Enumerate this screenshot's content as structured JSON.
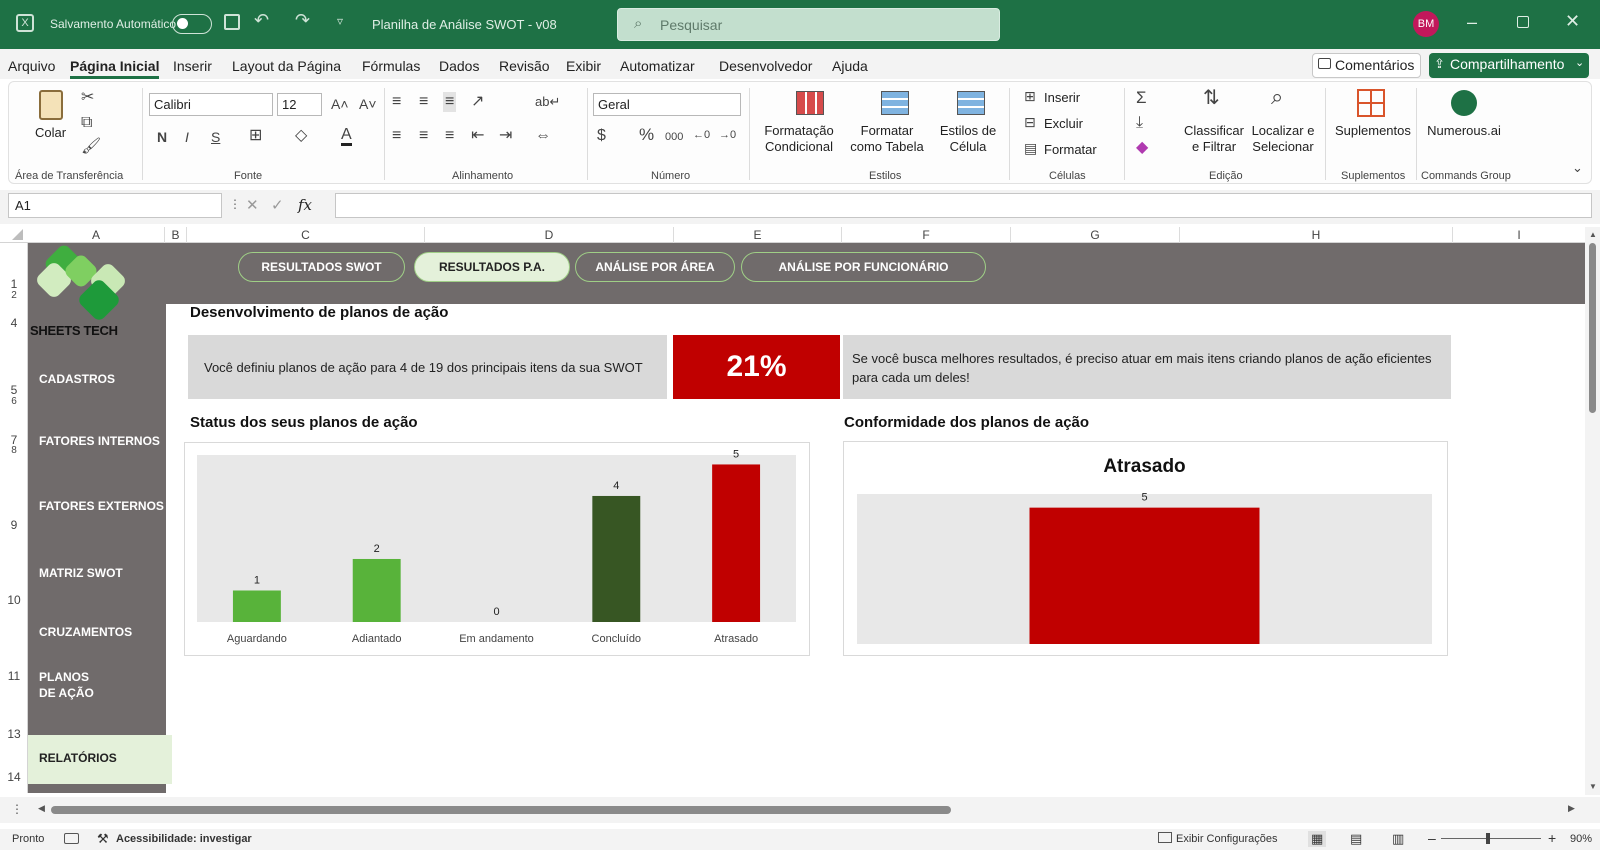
{
  "titlebar": {
    "autosave_label": "Salvamento Automático",
    "doc_title": "Planilha de Análise SWOT - v08",
    "search_placeholder": "Pesquisar",
    "user_initials": "BM",
    "accent": "#1e7145"
  },
  "menu": {
    "items": [
      "Arquivo",
      "Página Inicial",
      "Inserir",
      "Layout da Página",
      "Fórmulas",
      "Dados",
      "Revisão",
      "Exibir",
      "Automatizar",
      "Desenvolvedor",
      "Ajuda"
    ],
    "active": "Página Inicial",
    "comments": "Comentários",
    "share": "Compartilhamento"
  },
  "ribbon": {
    "paste": "Colar",
    "clipboard_group": "Área de Transferência",
    "font_name": "Calibri",
    "font_size": "12",
    "font_group": "Fonte",
    "align_group": "Alinhamento",
    "number_format": "Geral",
    "number_group": "Número",
    "cond_format": "Formatação Condicional",
    "format_table": "Formatar como Tabela",
    "cell_styles": "Estilos de Célula",
    "styles_group": "Estilos",
    "insert": "Inserir",
    "delete": "Excluir",
    "format": "Formatar",
    "cells_group": "Células",
    "sort_filter": "Classificar e Filtrar",
    "find_select": "Localizar e Selecionar",
    "editing_group": "Edição",
    "addins": "Suplementos",
    "addins_group": "Suplementos",
    "numerous": "Numerous.ai",
    "commands_group": "Commands Group"
  },
  "formula_bar": {
    "name_box": "A1",
    "fx": "fx"
  },
  "columns": [
    "A",
    "B",
    "C",
    "D",
    "E",
    "F",
    "G",
    "H",
    "I"
  ],
  "rows": [
    "1",
    "2",
    "4",
    "5",
    "6",
    "7",
    "8",
    "9",
    "10",
    "11",
    "13",
    "14"
  ],
  "dashboard": {
    "logo_text": "SHEETS TECH",
    "tabs": [
      "RESULTADOS SWOT",
      "RESULTADOS P.A.",
      "ANÁLISE POR ÁREA",
      "ANÁLISE POR FUNCIONÁRIO"
    ],
    "active_tab": "RESULTADOS P.A.",
    "side_menu": [
      "CADASTROS",
      "FATORES INTERNOS",
      "FATORES EXTERNOS",
      "MATRIZ SWOT",
      "CRUZAMENTOS",
      "PLANOS DE AÇÃO",
      "RELATÓRIOS"
    ],
    "active_side": "RELATÓRIOS",
    "section_title": "Desenvolvimento de planos de ação",
    "summary_text": "Você definiu planos de ação para 4 de 19 dos principais itens da sua SWOT",
    "percent": "21%",
    "advice_text": "Se você busca melhores resultados, é preciso atuar em mais itens criando planos de ação eficientes para cada um deles!",
    "status_title": "Status dos seus planos de ação",
    "conformity_title": "Conformidade dos planos de ação"
  },
  "chart_data": [
    {
      "type": "bar",
      "categories": [
        "Aguardando",
        "Adiantado",
        "Em andamento",
        "Concluído",
        "Atrasado"
      ],
      "values": [
        1,
        2,
        0,
        4,
        5
      ],
      "colors": [
        "#58b33a",
        "#58b33a",
        "#58b33a",
        "#375623",
        "#c00000"
      ],
      "ylim": [
        0,
        5.3
      ],
      "data_labels": true,
      "grid": false
    },
    {
      "type": "bar",
      "title": "Atrasado",
      "categories": [
        "Atrasado"
      ],
      "values": [
        5
      ],
      "colors": [
        "#c00000"
      ],
      "ylim": [
        0,
        5.5
      ],
      "data_labels": true,
      "grid": false
    }
  ],
  "status_bar": {
    "ready": "Pronto",
    "accessibility": "Acessibilidade: investigar",
    "display_settings": "Exibir Configurações",
    "zoom": "90%"
  }
}
